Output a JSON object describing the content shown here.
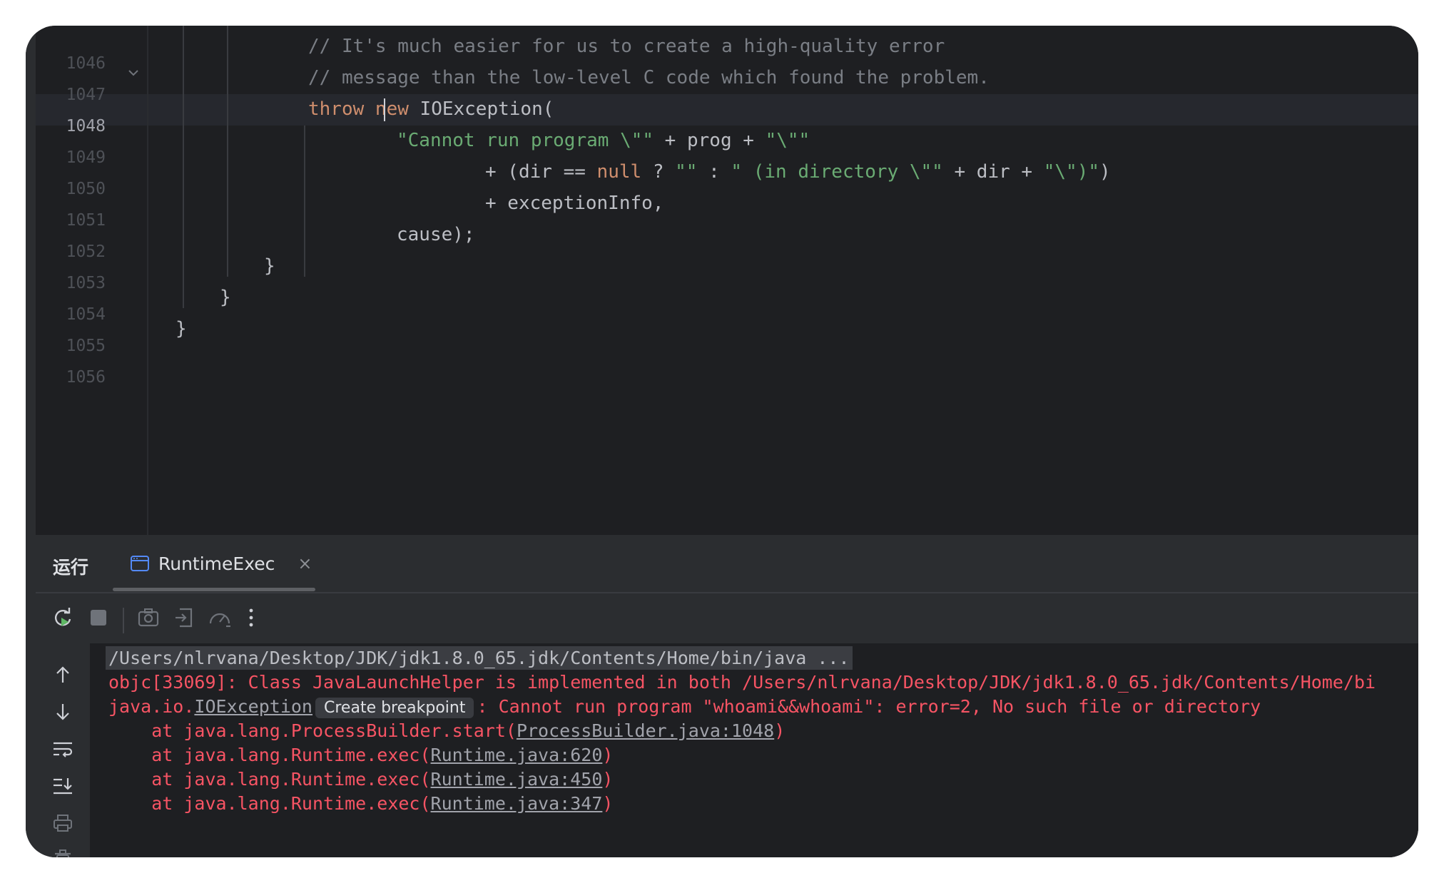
{
  "editor": {
    "line_numbers": [
      "1046",
      "1047",
      "1048",
      "1049",
      "1050",
      "1051",
      "1052",
      "1053",
      "1054",
      "1055",
      "1056"
    ],
    "active_line": "1048",
    "lines": {
      "l1046": "// It's much easier for us to create a high-quality error",
      "l1047": "// message than the low-level C code which found the problem.",
      "l1048_kw1": "throw ",
      "l1048_kw2": "new",
      "l1048_rest": " IOException(",
      "l1049_str": "\"Cannot run program \\\"\"",
      "l1049_rest": " + prog + ",
      "l1049_str2": "\"\\\"\"",
      "l1050_a": "+ (dir == ",
      "l1050_kw": "null",
      "l1050_b": " ? ",
      "l1050_s1": "\"\"",
      "l1050_c": " : ",
      "l1050_s2": "\" (in directory \\\"\"",
      "l1050_d": " + dir + ",
      "l1050_s3": "\"\\\")\"",
      "l1050_e": ")",
      "l1051": "+ exceptionInfo,",
      "l1052": "cause);",
      "l1053": "}",
      "l1054": "}",
      "l1055": "}"
    }
  },
  "run_panel": {
    "title": "运行",
    "tab_label": "RuntimeExec",
    "tab_close": "×"
  },
  "console": {
    "cmd": "/Users/nlrvana/Desktop/JDK/jdk1.8.0_65.jdk/Contents/Home/bin/java ...",
    "objc": "objc[33069]: Class JavaLaunchHelper is implemented in both /Users/nlrvana/Desktop/JDK/jdk1.8.0_65.jdk/Contents/Home/bi",
    "ex_prefix": "java.io.",
    "ex_link": "IOException",
    "breakpoint_hint": "Create breakpoint",
    "ex_msg": ": Cannot run program \"whoami&&whoami\": error=2, No such file or directory",
    "stack": [
      {
        "prefix": "    at java.lang.ProcessBuilder.start(",
        "link": "ProcessBuilder.java:1048",
        "suffix": ")"
      },
      {
        "prefix": "    at java.lang.Runtime.exec(",
        "link": "Runtime.java:620",
        "suffix": ")"
      },
      {
        "prefix": "    at java.lang.Runtime.exec(",
        "link": "Runtime.java:450",
        "suffix": ")"
      },
      {
        "prefix": "    at java.lang.Runtime.exec(",
        "link": "Runtime.java:347",
        "suffix": ")"
      }
    ]
  },
  "icons": {
    "toolbar": [
      "rerun-icon",
      "stop-icon",
      "screenshot-icon",
      "restore-layout-icon",
      "profiler-icon",
      "more-icon"
    ],
    "side": [
      "up-arrow-icon",
      "down-arrow-icon",
      "soft-wrap-icon",
      "scroll-to-end-icon",
      "print-icon",
      "clear-icon"
    ]
  }
}
